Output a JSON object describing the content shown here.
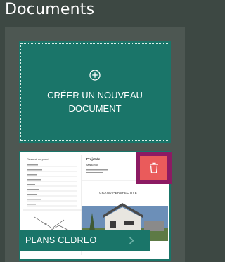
{
  "header": {
    "title": "Documents"
  },
  "create_card": {
    "label": "CRÉER UN NOUVEAU DOCUMENT",
    "icon": "plus-circle-icon"
  },
  "documents": [
    {
      "name": "PLANS CEDREO",
      "thumbnail_heading": "Résumé du projet",
      "thumbnail_project_label": "Projet de",
      "thumbnail_project_name": "Maison A",
      "thumbnail_caption": "GRAND PERSPECTIVE",
      "delete_icon": "trash-icon",
      "open_icon": "chevron-right-icon"
    }
  ],
  "colors": {
    "background": "#3d4843",
    "panel": "#4d5752",
    "accent": "#1a7569",
    "delete": "#ea5b5b",
    "highlight": "#8c1a63"
  }
}
